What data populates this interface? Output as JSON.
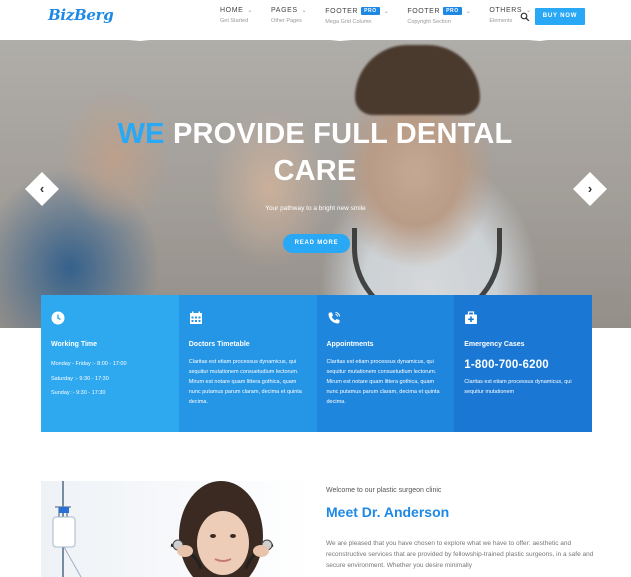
{
  "brand": {
    "logo_text": "BizBerg",
    "accent_color": "#29a9f5"
  },
  "nav": {
    "items": [
      {
        "label": "HOME",
        "sub": "Get Started",
        "pro": ""
      },
      {
        "label": "PAGES",
        "sub": "Other Pages",
        "pro": ""
      },
      {
        "label": "FOOTER",
        "sub": "Mega Grid Column",
        "pro": "PRO"
      },
      {
        "label": "FOOTER",
        "sub": "Copyright Section",
        "pro": "PRO"
      },
      {
        "label": "OTHERS",
        "sub": "Elements",
        "pro": ""
      }
    ],
    "search_icon": "search-icon",
    "buy_label": "BUY NOW"
  },
  "hero": {
    "title_accent": "WE",
    "title_rest": "PROVIDE FULL DENTAL CARE",
    "subtitle": "Your pathway to a bright new smile",
    "button_label": "READ MORE",
    "prev_icon": "chevron-left-icon",
    "next_icon": "chevron-right-icon"
  },
  "info_boxes": [
    {
      "icon": "clock-icon",
      "title": "Working Time",
      "color": "#2ea8ef",
      "hours": [
        "Monday - Friday :- 8:00 - 17:00",
        "Saturday :- 9:30 - 17:30",
        "Sunday :- 9:30 - 17:30"
      ]
    },
    {
      "icon": "calendar-icon",
      "title": "Doctors Timetable",
      "color": "#2595e6",
      "text": "Claritas est etiam processus dynamicus, qui sequitur mutationem consuetudium lectorum. Mirum est notare quam littera gothica, quam nunc putamus parum claram, decima et quinta decima."
    },
    {
      "icon": "phone-icon",
      "title": "Appointments",
      "color": "#1f86de",
      "text": "Claritas est etiam processus dynamicus, qui sequitur mutationem consuetudium lectorum. Mirum est notare quam littera gothica, quam nunc putamus parum claram, decima et quinta decima."
    },
    {
      "icon": "medical-kit-icon",
      "title": "Emergency Cases",
      "color": "#1a78d4",
      "phone": "1-800-700-6200",
      "text": "Claritas est etiam processus dynamicus, qui sequitur mutationem"
    }
  ],
  "doctor": {
    "welcome": "Welcome to our plastic surgeon clinic",
    "title": "Meet Dr. Anderson",
    "text": "We are pleased that you have chosen to explore what we have to offer: aesthetic and reconstructive services that are provided by fellowship-trained plastic surgeons, in a safe and secure environment. Whether you desire minimally"
  }
}
